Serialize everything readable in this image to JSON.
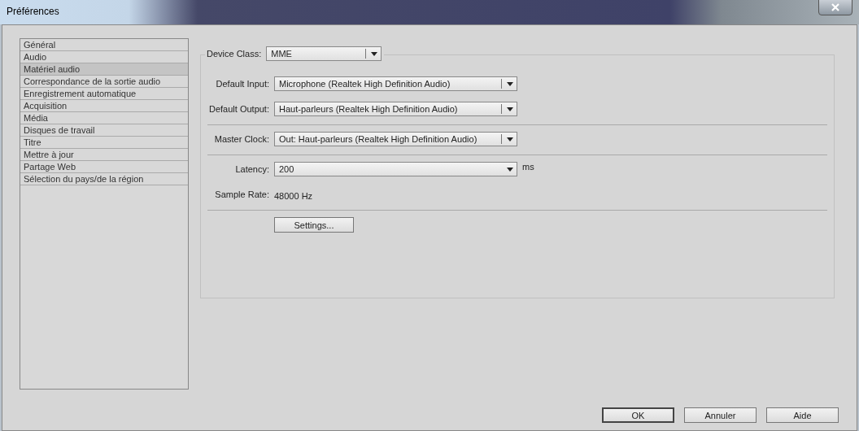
{
  "window": {
    "title": "Préférences"
  },
  "sidebar": {
    "items": [
      {
        "label": "Général",
        "selected": false
      },
      {
        "label": "Audio",
        "selected": false
      },
      {
        "label": "Matériel audio",
        "selected": true
      },
      {
        "label": "Correspondance de la sortie audio",
        "selected": false
      },
      {
        "label": "Enregistrement automatique",
        "selected": false
      },
      {
        "label": "Acquisition",
        "selected": false
      },
      {
        "label": "Média",
        "selected": false
      },
      {
        "label": "Disques de travail",
        "selected": false
      },
      {
        "label": "Titre",
        "selected": false
      },
      {
        "label": "Mettre à jour",
        "selected": false
      },
      {
        "label": "Partage Web",
        "selected": false
      },
      {
        "label": "Sélection du pays/de la région",
        "selected": false
      }
    ]
  },
  "device_class": {
    "label": "Device Class:",
    "value": "MME"
  },
  "groups": [
    [
      {
        "kind": "dropdown",
        "label": "Default Input:",
        "value": "Microphone (Realtek High Definition Audio)"
      },
      {
        "kind": "dropdown",
        "label": "Default Output:",
        "value": "Haut-parleurs (Realtek High Definition Audio)"
      }
    ],
    [
      {
        "kind": "dropdown",
        "label": "Master Clock:",
        "value": "Out: Haut-parleurs (Realtek High Definition Audio)"
      }
    ],
    [
      {
        "kind": "combo",
        "label": "Latency:",
        "value": "200",
        "unit": "ms"
      },
      {
        "kind": "text",
        "label": "Sample Rate:",
        "value": "48000 Hz"
      }
    ],
    [
      {
        "kind": "button",
        "label": "Settings..."
      }
    ]
  ],
  "buttons": [
    {
      "label": "OK",
      "default": true
    },
    {
      "label": "Annuler",
      "default": false
    },
    {
      "label": "Aide",
      "default": false
    }
  ]
}
